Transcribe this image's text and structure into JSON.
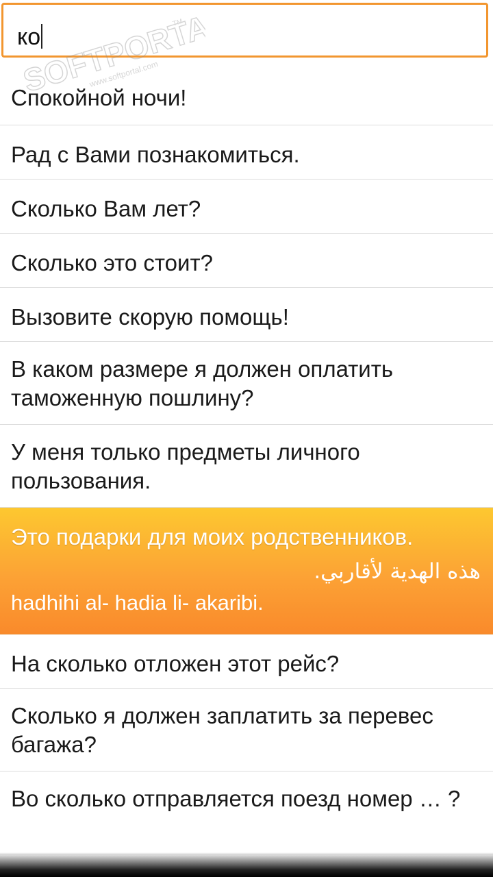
{
  "search": {
    "value": "ко"
  },
  "watermark": {
    "brand": "SOFTPORTAL",
    "url": "www.softportal.com",
    "tm": "TM"
  },
  "phrases": [
    {
      "text": "Спокойной ночи!"
    },
    {
      "text": "Рад с Вами познакомиться."
    },
    {
      "text": "Сколько Вам лет?"
    },
    {
      "text": "Сколько это стоит?"
    },
    {
      "text": "Вызовите скорую помощь!"
    },
    {
      "text": "В каком размере я должен оплатить таможенную пошлину?"
    },
    {
      "text": "У меня только предметы личного пользования."
    },
    {
      "text": "Это подарки для моих родственников.",
      "arabic": "هذه الهدية لأقاربي.",
      "transliteration": "hadhihi al- hadia li- akaribi.",
      "selected": true
    },
    {
      "text": "На сколько отложен этот рейс?"
    },
    {
      "text": "Сколько я должен заплатить за перевес багажа?"
    },
    {
      "text": "Во сколько отправляется поезд номер … ?"
    }
  ],
  "colors": {
    "accent": "#f2962f",
    "selected_top": "#fdc830",
    "selected_bottom": "#f98a2b"
  }
}
